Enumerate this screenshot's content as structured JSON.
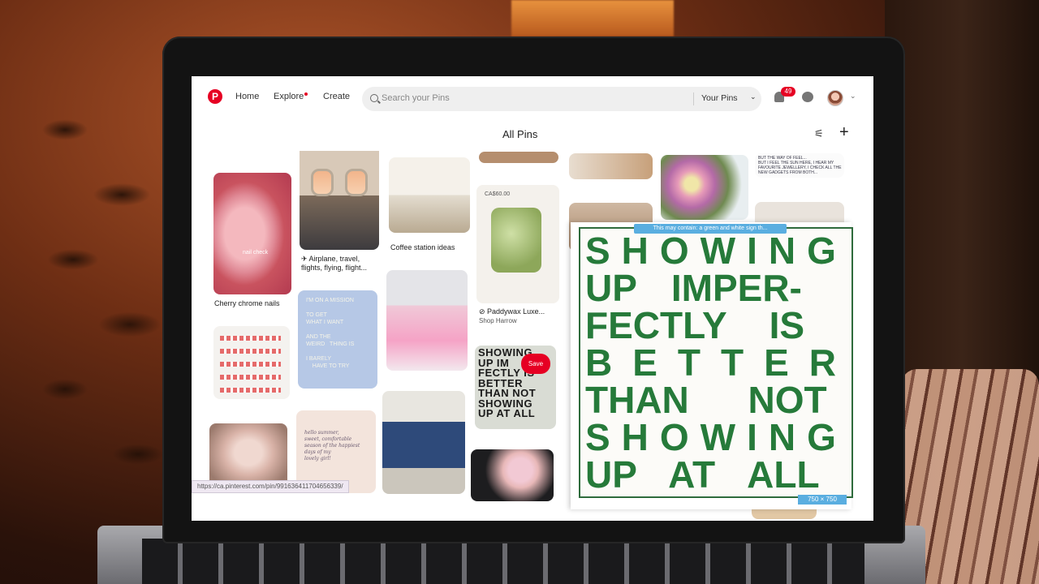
{
  "nav": {
    "home": "Home",
    "explore": "Explore",
    "create": "Create",
    "search_placeholder": "Search your Pins",
    "your_pins": "Your Pins",
    "notification_count": "49"
  },
  "page": {
    "title": "All Pins"
  },
  "pins": {
    "nails_caption": "Cherry chrome nails",
    "nails_overlay": "nail check",
    "plane_caption": "✈ Airplane, travel, flights, flying, flight...",
    "coffee_caption": "Coffee station ideas",
    "candle_price": "CA$60.00",
    "candle_caption": "⊘ Paddywax Luxe...",
    "candle_source": "Shop Harrow",
    "mission_text": "I'M ON A MISSION\n\nTO GET\nWHAT I WANT\n\nAND THE\nWEIRD   THING IS\n\nI BARELY\n    HAVE TO TRY",
    "showing_small": "SHOWING\nUP IM\nFECTLY IS\nBETTER\nTHAN NOT\nSHOWING\nUP AT ALL",
    "save_label": "Save",
    "letter_text": "hello summer,\nsweet, comfortable\nseason of the happiest\ndays of my\nlovely girl!",
    "note_text": "BUT THE WAY OF FEEL...\nBUT I FEEL THE SUN HERE, I HEAR MY\nFAVOURITE JEWELLERY, I CHECK ALL THE\nNEW GADGETS FROM BOTH..."
  },
  "preview": {
    "tooltip": "This may contain: a green and white sign th...",
    "lines": [
      "SHOWING",
      "UP IMPER-",
      "FECTLY IS",
      "BETTER",
      "THAN NOT",
      "SHOWING",
      "UP AT ALL"
    ],
    "size": "750 × 750"
  },
  "status_url": "https://ca.pinterest.com/pin/991636411704656339/",
  "colors": {
    "brand": "#e60023",
    "accent_green": "#267a3a",
    "selection_blue": "#5aaee0"
  },
  "icons": [
    "pinterest-logo-icon",
    "search-icon",
    "chevron-down-icon",
    "bell-icon",
    "message-icon",
    "filter-icon",
    "plus-icon"
  ]
}
